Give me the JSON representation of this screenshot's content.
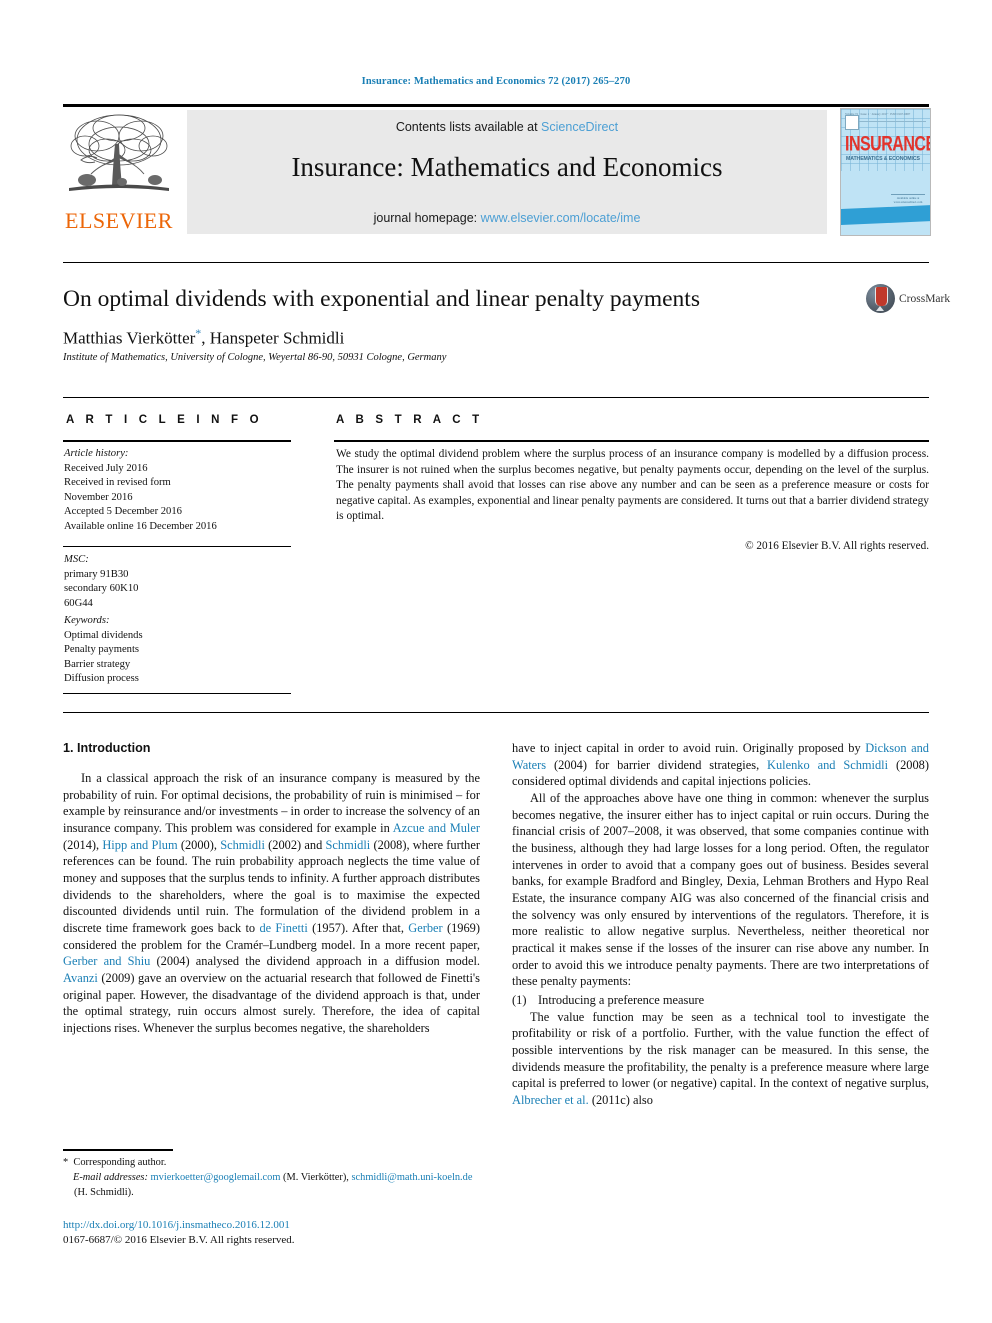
{
  "running_head": "Insurance: Mathematics and Economics 72 (2017) 265–270",
  "masthead": {
    "publisher": "ELSEVIER",
    "contents_prefix": "Contents lists available at ",
    "contents_link": "ScienceDirect",
    "journal_title": "Insurance: Mathematics and Economics",
    "homepage_prefix": "journal homepage: ",
    "homepage_link": "www.elsevier.com/locate/ime",
    "cover": {
      "word": "INSURANCE",
      "subtitle": "MATHEMATICS & ECONOMICS",
      "topbar": "Volume 72 · Issue 1 · January 2017 · ISSN 0167-6687",
      "box_label": "Available online at www.sciencedirect.com"
    }
  },
  "article": {
    "title": "On optimal dividends with exponential and linear penalty payments",
    "authors": "Matthias Vierkötter",
    "authors_rest": ", Hanspeter Schmidli",
    "affiliation": "Institute of Mathematics, University of Cologne, Weyertal 86-90, 50931 Cologne, Germany",
    "crossmark_label": "CrossMark"
  },
  "info": {
    "heading": "A R T I C L E  I N F O",
    "history_label": "Article history:",
    "history": [
      "Received July 2016",
      "Received in revised form",
      "November 2016",
      "Accepted 5 December 2016",
      "Available online 16 December 2016"
    ],
    "msc_label": "MSC:",
    "msc": [
      "primary 91B30",
      "secondary 60K10",
      "60G44"
    ],
    "keywords_label": "Keywords:",
    "keywords": [
      "Optimal dividends",
      "Penalty payments",
      "Barrier strategy",
      "Diffusion process"
    ]
  },
  "abstract": {
    "heading": "A B S T R A C T",
    "text": "We study the optimal dividend problem where the surplus process of an insurance company is modelled by a diffusion process. The insurer is not ruined when the surplus becomes negative, but penalty payments occur, depending on the level of the surplus. The penalty payments shall avoid that losses can rise above any number and can be seen as a preference measure or costs for negative capital. As examples, exponential and linear penalty payments are considered. It turns out that a barrier dividend strategy is optimal.",
    "copyright": "© 2016 Elsevier B.V. All rights reserved."
  },
  "body": {
    "section_title": "1. Introduction",
    "left_p1_a": "In a classical approach the risk of an insurance company is measured by the probability of ruin. For optimal decisions, the probability of ruin is minimised – for example by reinsurance and/or investments – in order to increase the solvency of an insurance company. This problem was considered for example in ",
    "left_p1_r1": "Azcue and Muler",
    "left_p1_b": " (2014), ",
    "left_p1_r2": "Hipp and Plum",
    "left_p1_c": " (2000), ",
    "left_p1_r3": "Schmidli",
    "left_p1_d": " (2002) and ",
    "left_p1_r4": "Schmidli",
    "left_p1_e": " (2008), where further references can be found. The ruin probability approach neglects the time value of money and supposes that the surplus tends to infinity. A further approach distributes dividends to the shareholders, where the goal is to maximise the expected discounted dividends until ruin. The formulation of the dividend problem in a discrete time framework goes back to ",
    "left_p1_r5": "de Finetti",
    "left_p1_f": " (1957). After that, ",
    "left_p1_r6": "Gerber",
    "left_p1_g": " (1969) considered the problem for the Cramér–Lundberg model. In a more recent paper, ",
    "left_p1_r7": "Gerber and Shiu",
    "left_p1_h": " (2004) analysed the dividend approach in a diffusion model. ",
    "left_p1_r8": "Avanzi",
    "left_p1_i": " (2009) gave an overview on the actuarial research that followed de Finetti's original paper. However, the disadvantage of the dividend approach is that, under the optimal strategy, ruin occurs almost surely. Therefore, the idea of capital injections rises. Whenever the surplus becomes negative, the shareholders",
    "right_p1_a": "have to inject capital in order to avoid ruin. Originally proposed by ",
    "right_p1_r1": "Dickson and Waters",
    "right_p1_b": " (2004) for barrier dividend strategies, ",
    "right_p1_r2": "Kulenko and Schmidli",
    "right_p1_c": " (2008) considered optimal dividends and capital injections policies.",
    "right_p2": "All of the approaches above have one thing in common: whenever the surplus becomes negative, the insurer either has to inject capital or ruin occurs. During the financial crisis of 2007–2008, it was observed, that some companies continue with the business, although they had large losses for a long period. Often, the regulator intervenes in order to avoid that a company goes out of business. Besides several banks, for example Bradford and Bingley, Dexia, Lehman Brothers and Hypo Real Estate, the insurance company AIG was also concerned of the financial crisis and the solvency was only ensured by interventions of the regulators. Therefore, it is more realistic to allow negative surplus. Nevertheless, neither theoretical nor practical it makes sense if the losses of the insurer can rise above any number. In order to avoid this we introduce penalty payments. There are two interpretations of these penalty payments:",
    "list_marker_1": "(1)",
    "list_text_1": "Introducing a preference measure",
    "right_p3_a": "The value function may be seen as a technical tool to investigate the profitability or risk of a portfolio. Further, with the value function the effect of possible interventions by the risk manager can be measured. In this sense, the dividends measure the profitability, the penalty is a preference measure where large capital is preferred to lower (or negative) capital. In the context of negative surplus, ",
    "right_p3_r1": "Albrecher et al.",
    "right_p3_b": " (2011c) also"
  },
  "footer": {
    "corresponding": "Corresponding author.",
    "email_label": "E-mail addresses:",
    "email1": "mvierkoetter@googlemail.com",
    "email1_name": " (M. Vierkötter),",
    "email2": "schmidli@math.uni-koeln.de",
    "email2_name": " (H. Schmidli).",
    "doi": "http://dx.doi.org/10.1016/j.insmatheco.2016.12.001",
    "issn_line": "0167-6687/© 2016 Elsevier B.V. All rights reserved."
  },
  "colors": {
    "link_blue": "#1a7fb5",
    "masthead_link": "#4c9fd4",
    "elsevier_orange": "#ec6608",
    "cover_red": "#e2342c",
    "cover_blue": "#2f9fd5"
  }
}
